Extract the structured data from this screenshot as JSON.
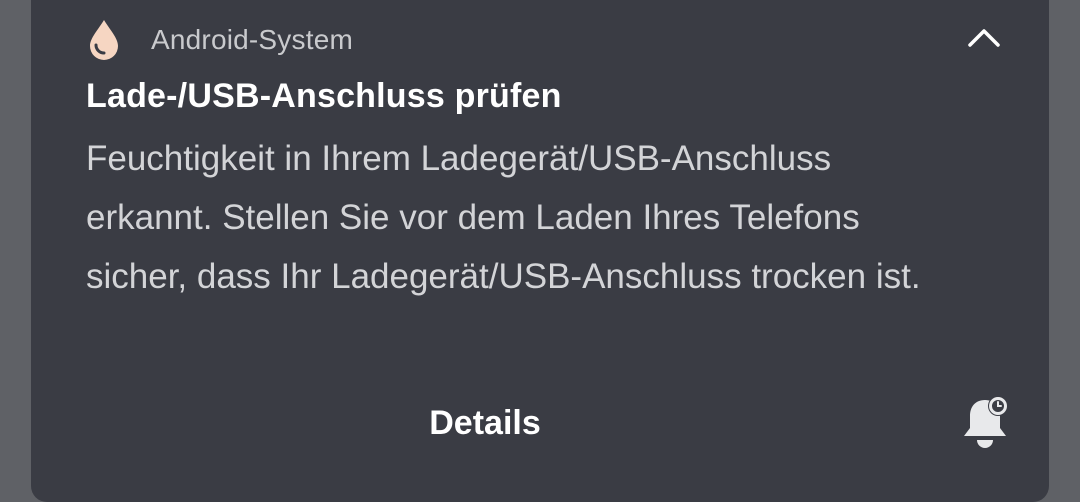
{
  "notification": {
    "app_name": "Android-System",
    "app_icon": "water-drop-icon",
    "title": "Lade-/USB-Anschluss prüfen",
    "message": "Feuchtigkeit in Ihrem Ladegerät/USB-Anschluss erkannt. Stellen Sie vor dem Laden Ihres Telefons sicher, dass Ihr Ladegerät/USB-Anschluss trocken ist.",
    "action_label": "Details",
    "collapse_icon": "chevron-up-icon",
    "snooze_icon": "bell-snooze-icon",
    "colors": {
      "card_background": "#3a3c44",
      "page_background": "#5f6166",
      "icon_accent": "#f6d6c2"
    }
  }
}
